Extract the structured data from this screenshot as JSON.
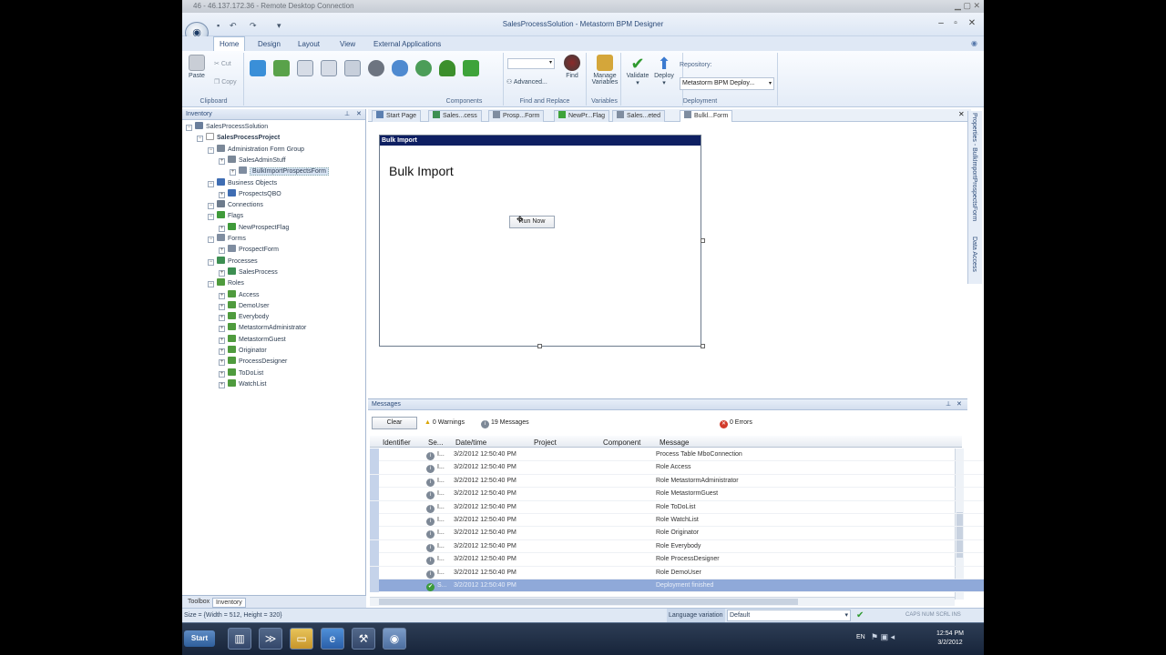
{
  "rdp_title": "46 - 46.137.172.36 - Remote Desktop Connection",
  "app_title": "SalesProcessSolution - Metastorm BPM Designer",
  "ribbon_tabs": [
    "Home",
    "Design",
    "Layout",
    "View",
    "External Applications"
  ],
  "clipboard": {
    "paste": "Paste",
    "cut": "Cut",
    "copy": "Copy",
    "label": "Clipboard"
  },
  "components_label": "Components",
  "find": {
    "advanced": "Advanced...",
    "find": "Find",
    "label": "Find and Replace"
  },
  "variables": {
    "manage": "Manage",
    "variables": "Variables",
    "label": "Variables"
  },
  "deployment": {
    "validate": "Validate",
    "deploy": "Deploy",
    "repository_label": "Repository:",
    "repository_value": "Metastorm BPM Deploy...",
    "label": "Deployment"
  },
  "inventory": {
    "title": "Inventory",
    "tree": [
      {
        "label": "SalesProcessSolution",
        "level": 0,
        "color": "#6a7e9b"
      },
      {
        "label": "SalesProcessProject",
        "level": 1,
        "bold": true,
        "color": "#ffffff"
      },
      {
        "label": "Administration Form Group",
        "level": 2,
        "color": "#7b8898"
      },
      {
        "label": "SalesAdminStuff",
        "level": 3,
        "color": "#7b8898"
      },
      {
        "label": "BulkImportProspectsForm",
        "level": 4,
        "selected": true,
        "color": "#7f8da0"
      },
      {
        "label": "Business Objects",
        "level": 2,
        "color": "#3f6db3"
      },
      {
        "label": "ProspectsQBO",
        "level": 3,
        "color": "#3f6db3"
      },
      {
        "label": "Connections",
        "level": 2,
        "color": "#6d7b8c"
      },
      {
        "label": "Flags",
        "level": 2,
        "color": "#3f9a3a"
      },
      {
        "label": "NewProspectFlag",
        "level": 3,
        "color": "#3f9a3a"
      },
      {
        "label": "Forms",
        "level": 2,
        "color": "#7f8da0"
      },
      {
        "label": "ProspectForm",
        "level": 3,
        "color": "#7f8da0"
      },
      {
        "label": "Processes",
        "level": 2,
        "color": "#3d8f52"
      },
      {
        "label": "SalesProcess",
        "level": 3,
        "color": "#3d8f52"
      },
      {
        "label": "Roles",
        "level": 2,
        "color": "#4f9b3e"
      },
      {
        "label": "Access",
        "level": 3,
        "color": "#4f9b3e"
      },
      {
        "label": "DemoUser",
        "level": 3,
        "color": "#4f9b3e"
      },
      {
        "label": "Everybody",
        "level": 3,
        "color": "#4f9b3e"
      },
      {
        "label": "MetastormAdministrator",
        "level": 3,
        "color": "#4f9b3e"
      },
      {
        "label": "MetastormGuest",
        "level": 3,
        "color": "#4f9b3e"
      },
      {
        "label": "Originator",
        "level": 3,
        "color": "#4f9b3e"
      },
      {
        "label": "ProcessDesigner",
        "level": 3,
        "color": "#4f9b3e"
      },
      {
        "label": "ToDoList",
        "level": 3,
        "color": "#4f9b3e"
      },
      {
        "label": "WatchList",
        "level": 3,
        "color": "#4f9b3e"
      }
    ],
    "bottom_tabs": [
      "Toolbox",
      "Inventory"
    ]
  },
  "doc_tabs": [
    "Start Page",
    "Sales...cess",
    "Prosp...Form",
    "NewPr...Flag",
    "Sales...eted",
    "Bulkl...Form"
  ],
  "form": {
    "header": "Bulk Import",
    "title": "Bulk Import",
    "button": "Run Now"
  },
  "side_tabs": [
    "Properties - BulkImportProspectsForm",
    "Data Access"
  ],
  "messages": {
    "title": "Messages",
    "clear": "Clear",
    "warnings": "0 Warnings",
    "info": "19 Messages",
    "errors": "0 Errors",
    "columns": [
      "Identifier",
      "Se...",
      "Date/time",
      "Project",
      "Component",
      "Message"
    ],
    "rows": [
      {
        "sev": "I...",
        "date": "3/2/2012 12:50:40 PM",
        "message": "Process Table MboConnection"
      },
      {
        "sev": "I...",
        "date": "3/2/2012 12:50:40 PM",
        "message": "Role Access"
      },
      {
        "sev": "I...",
        "date": "3/2/2012 12:50:40 PM",
        "message": "Role MetastormAdministrator"
      },
      {
        "sev": "I...",
        "date": "3/2/2012 12:50:40 PM",
        "message": "Role MetastormGuest"
      },
      {
        "sev": "I...",
        "date": "3/2/2012 12:50:40 PM",
        "message": "Role ToDoList"
      },
      {
        "sev": "I...",
        "date": "3/2/2012 12:50:40 PM",
        "message": "Role WatchList"
      },
      {
        "sev": "I...",
        "date": "3/2/2012 12:50:40 PM",
        "message": "Role Originator"
      },
      {
        "sev": "I...",
        "date": "3/2/2012 12:50:40 PM",
        "message": "Role Everybody"
      },
      {
        "sev": "I...",
        "date": "3/2/2012 12:50:40 PM",
        "message": "Role ProcessDesigner"
      },
      {
        "sev": "I...",
        "date": "3/2/2012 12:50:40 PM",
        "message": "Role DemoUser"
      },
      {
        "sev": "S...",
        "date": "3/2/2012 12:50:40 PM",
        "message": "Deployment finished",
        "highlight": true
      }
    ]
  },
  "status": {
    "size": "Size = {Width = 512, Height = 320}",
    "language_label": "Language variation",
    "language_value": "Default",
    "indicators": "CAPS  NUM  SCRL  INS"
  },
  "taskbar": {
    "start": "Start",
    "lang": "EN",
    "time": "12:54 PM",
    "date": "3/2/2012"
  }
}
